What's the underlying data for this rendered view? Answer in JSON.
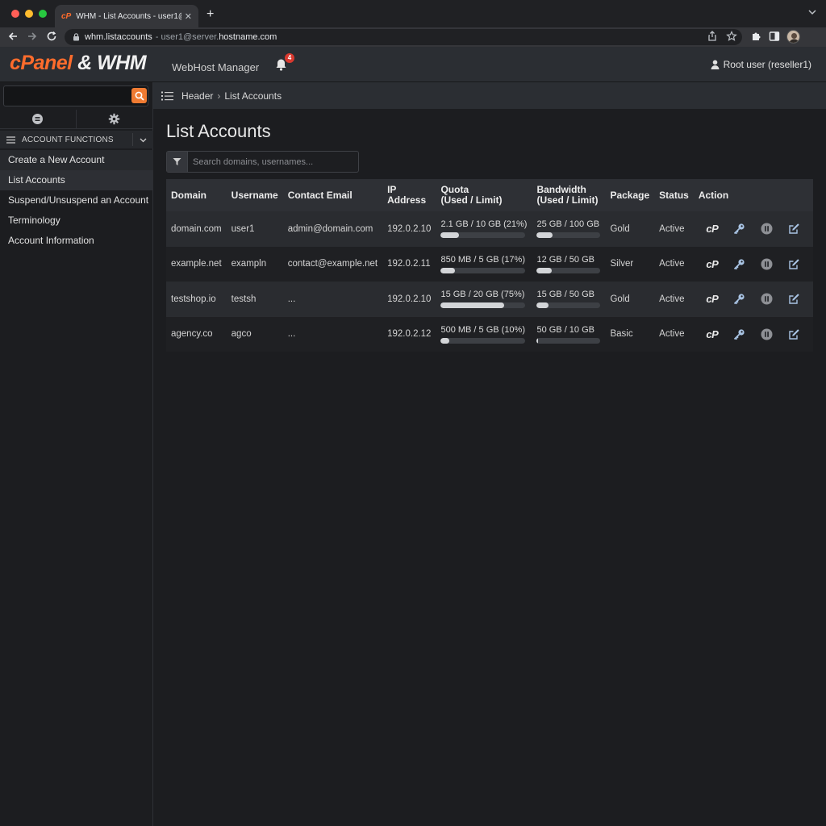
{
  "browser": {
    "tab_title": "WHM - List Accounts - user1@",
    "favicon_text": "cP",
    "url_main": "whm.listaccounts",
    "url_sep": " - user1@server.",
    "url_host": "hostname.com",
    "colors": {
      "close": "#ff5f57",
      "minimize": "#febc2e",
      "maximize": "#28c840"
    }
  },
  "header": {
    "logo_cpanel": "cPanel",
    "logo_amp": "&",
    "logo_whm": "WHM",
    "subtitle": "WebHost Manager",
    "notification_count": "4",
    "user_label": "Root user (reseller1)"
  },
  "sidebar": {
    "search_placeholder": "",
    "section_label": "ACCOUNT FUNCTIONS",
    "items": [
      {
        "label": "Create a New Account"
      },
      {
        "label": "List Accounts"
      },
      {
        "label": "Suspend/Unsuspend an Account"
      },
      {
        "label": "Terminology"
      },
      {
        "label": "Account Information"
      }
    ]
  },
  "breadcrumb": {
    "root": "Header",
    "sep": "›",
    "current": "List Accounts"
  },
  "main": {
    "title": "List Accounts",
    "filter_placeholder": "Search domains, usernames...",
    "columns": {
      "domain": "Domain",
      "username": "Username",
      "email": "Contact Email",
      "ip": "IP Address",
      "quota_1": "Quota",
      "quota_2": "(Used / Limit)",
      "bw_1": "Bandwidth",
      "bw_2": "(Used / Limit)",
      "package": "Package",
      "status": "Status",
      "action": "Action"
    },
    "rows": [
      {
        "domain": "domain.com",
        "username": "user1",
        "email": "admin@domain.com",
        "ip": "192.0.2.10",
        "quota": "2.1 GB / 10 GB (21%)",
        "quota_pct": 21,
        "bandwidth": "25 GB / 100 GB",
        "bw_pct": 25,
        "package": "Gold",
        "status": "Active"
      },
      {
        "domain": "example.net",
        "username": "exampln",
        "email": "contact@example.net",
        "ip": "192.0.2.11",
        "quota": "850 MB / 5 GB (17%)",
        "quota_pct": 17,
        "bandwidth": "12 GB / 50 GB",
        "bw_pct": 24,
        "package": "Silver",
        "status": "Active"
      },
      {
        "domain": "testshop.io",
        "username": "testsh",
        "email": "...",
        "ip": "192.0.2.10",
        "quota": "15 GB / 20 GB (75%)",
        "quota_pct": 75,
        "bandwidth": "15 GB / 50 GB",
        "bw_pct": 18,
        "package": "Gold",
        "status": "Active"
      },
      {
        "domain": "agency.co",
        "username": "agco",
        "email": "...",
        "ip": "192.0.2.12",
        "quota": "500 MB / 5 GB (10%)",
        "quota_pct": 10,
        "bandwidth": "50 GB / 10 GB",
        "bw_pct": 2,
        "package": "Basic",
        "status": "Active"
      }
    ],
    "action_cp_label": "cP"
  }
}
